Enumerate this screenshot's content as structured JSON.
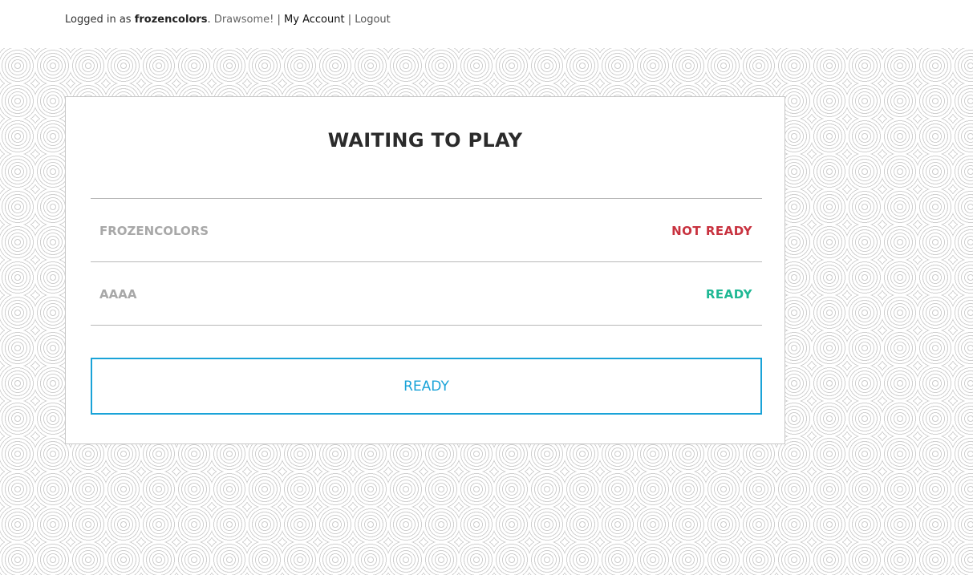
{
  "header": {
    "logged_in_prefix": "Logged in as",
    "username": "frozencolors",
    "dot": ".",
    "app_name": "Drawsome!",
    "separator": "|",
    "my_account": "My Account",
    "logout": "Logout"
  },
  "lobby": {
    "title": "WAITING TO PLAY",
    "players": [
      {
        "name": "FROZENCOLORS",
        "status": "NOT READY",
        "status_color": "#c8323f"
      },
      {
        "name": "AAAA",
        "status": "READY",
        "status_color": "#1fb894"
      }
    ],
    "ready_button_label": "READY"
  },
  "colors": {
    "accent": "#1aa3d8",
    "not_ready": "#c8323f",
    "ready": "#1fb894"
  }
}
